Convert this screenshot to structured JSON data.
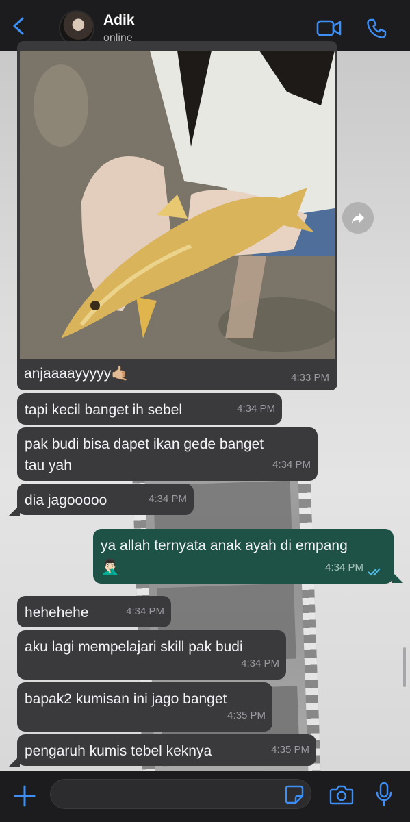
{
  "header": {
    "contact_name": "Adik",
    "contact_status": "online"
  },
  "image_message": {
    "caption": "anjaaaayyyyy🤙🏼",
    "time": "4:33 PM"
  },
  "messages": [
    {
      "direction": "in",
      "text": "tapi kecil banget ih sebel",
      "time": "4:34 PM"
    },
    {
      "direction": "in",
      "text_line1": "pak budi bisa dapet ikan gede banget",
      "text_line2": "tau yah",
      "time": "4:34 PM"
    },
    {
      "direction": "in",
      "text": "dia jagooooo",
      "time": "4:34 PM"
    },
    {
      "direction": "out",
      "text": "ya allah ternyata anak ayah di empang",
      "emoji": "🤦🏻‍♂️",
      "time": "4:34 PM",
      "status": "read"
    },
    {
      "direction": "in",
      "text": "hehehehe",
      "time": "4:34 PM"
    },
    {
      "direction": "in",
      "text": "aku lagi mempelajari skill pak budi",
      "time": "4:34 PM"
    },
    {
      "direction": "in",
      "text": "bapak2 kumisan ini jago banget",
      "time": "4:35 PM"
    },
    {
      "direction": "in",
      "text": "pengaruh kumis tebel keknya",
      "time": "4:35 PM"
    }
  ],
  "composer": {
    "value": "",
    "placeholder": ""
  },
  "icons": {
    "back": "back-chevron-icon",
    "video": "video-call-icon",
    "call": "phone-icon",
    "forward": "forward-icon",
    "plus": "plus-icon",
    "sticker": "sticker-icon",
    "camera": "camera-icon",
    "mic": "microphone-icon"
  },
  "colors": {
    "header_bg": "#1c1c1e",
    "accent": "#3d8ef5",
    "incoming_bubble": "#3a3a3c",
    "outgoing_bubble": "#1f5246",
    "read_ticks": "#53bdeb"
  }
}
